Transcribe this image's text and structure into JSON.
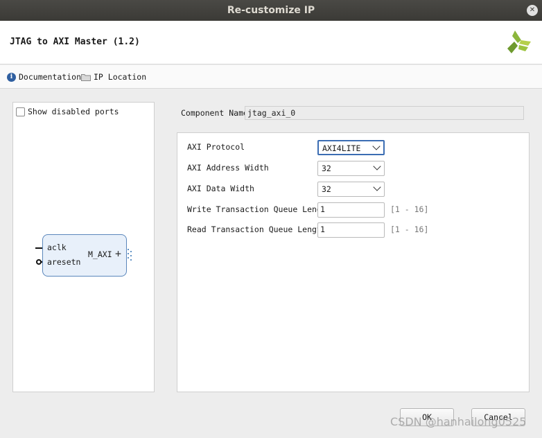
{
  "window": {
    "title": "Re-customize IP",
    "close_symbol": "✕"
  },
  "header": {
    "ip_title": "JTAG to AXI Master (1.2)"
  },
  "toolbar": {
    "documentation": "Documentation",
    "ip_location": "IP Location"
  },
  "left_panel": {
    "show_disabled_ports": "Show disabled ports",
    "block": {
      "ports_left": [
        "aclk",
        "aresetn"
      ],
      "port_right": "M_AXI",
      "plus": "+"
    }
  },
  "component": {
    "label": "Component Name",
    "value": "jtag_axi_0"
  },
  "params": [
    {
      "label": "AXI Protocol",
      "type": "select",
      "value": "AXI4LITE"
    },
    {
      "label": "AXI Address Width",
      "type": "select",
      "value": "32"
    },
    {
      "label": "AXI Data Width",
      "type": "select",
      "value": "32"
    },
    {
      "label": "Write Transaction Queue Length",
      "type": "input",
      "value": "1",
      "range": "[1 - 16]"
    },
    {
      "label": "Read Transaction Queue Length",
      "type": "input",
      "value": "1",
      "range": "[1 - 16]"
    }
  ],
  "buttons": {
    "ok": "OK",
    "cancel": "Cancel"
  },
  "watermark": "CSDN @hanhailong0525",
  "colors": {
    "accent": "#3b6db3",
    "block_fill": "#e8f0fa",
    "logo_green": "#8cb63c"
  }
}
